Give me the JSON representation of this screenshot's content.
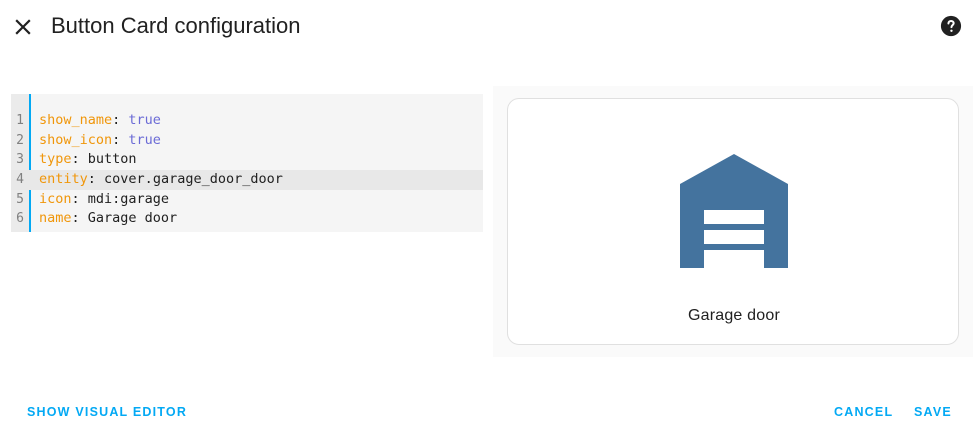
{
  "dialog": {
    "title": "Button Card configuration",
    "close_icon": "close-icon",
    "help_icon": "help-circle-icon"
  },
  "editor": {
    "lines": [
      {
        "number": "1",
        "key": "show_name",
        "value": "true",
        "value_type": "bool"
      },
      {
        "number": "2",
        "key": "show_icon",
        "value": "true",
        "value_type": "bool"
      },
      {
        "number": "3",
        "key": "type",
        "value": "button",
        "value_type": "string"
      },
      {
        "number": "4",
        "key": "entity",
        "value": "cover.garage_door_door",
        "value_type": "string",
        "active": true
      },
      {
        "number": "5",
        "key": "icon",
        "value": "mdi:garage",
        "value_type": "string"
      },
      {
        "number": "6",
        "key": "name",
        "value": "Garage door",
        "value_type": "string"
      }
    ]
  },
  "preview": {
    "icon": "garage-icon",
    "name": "Garage door"
  },
  "footer": {
    "show_visual_editor": "SHOW VISUAL EDITOR",
    "cancel": "CANCEL",
    "save": "SAVE"
  },
  "colors": {
    "accent": "#03a9f4",
    "yaml_key": "#f0960a",
    "yaml_bool": "#6b6bd6",
    "icon_blue": "#44739e"
  }
}
